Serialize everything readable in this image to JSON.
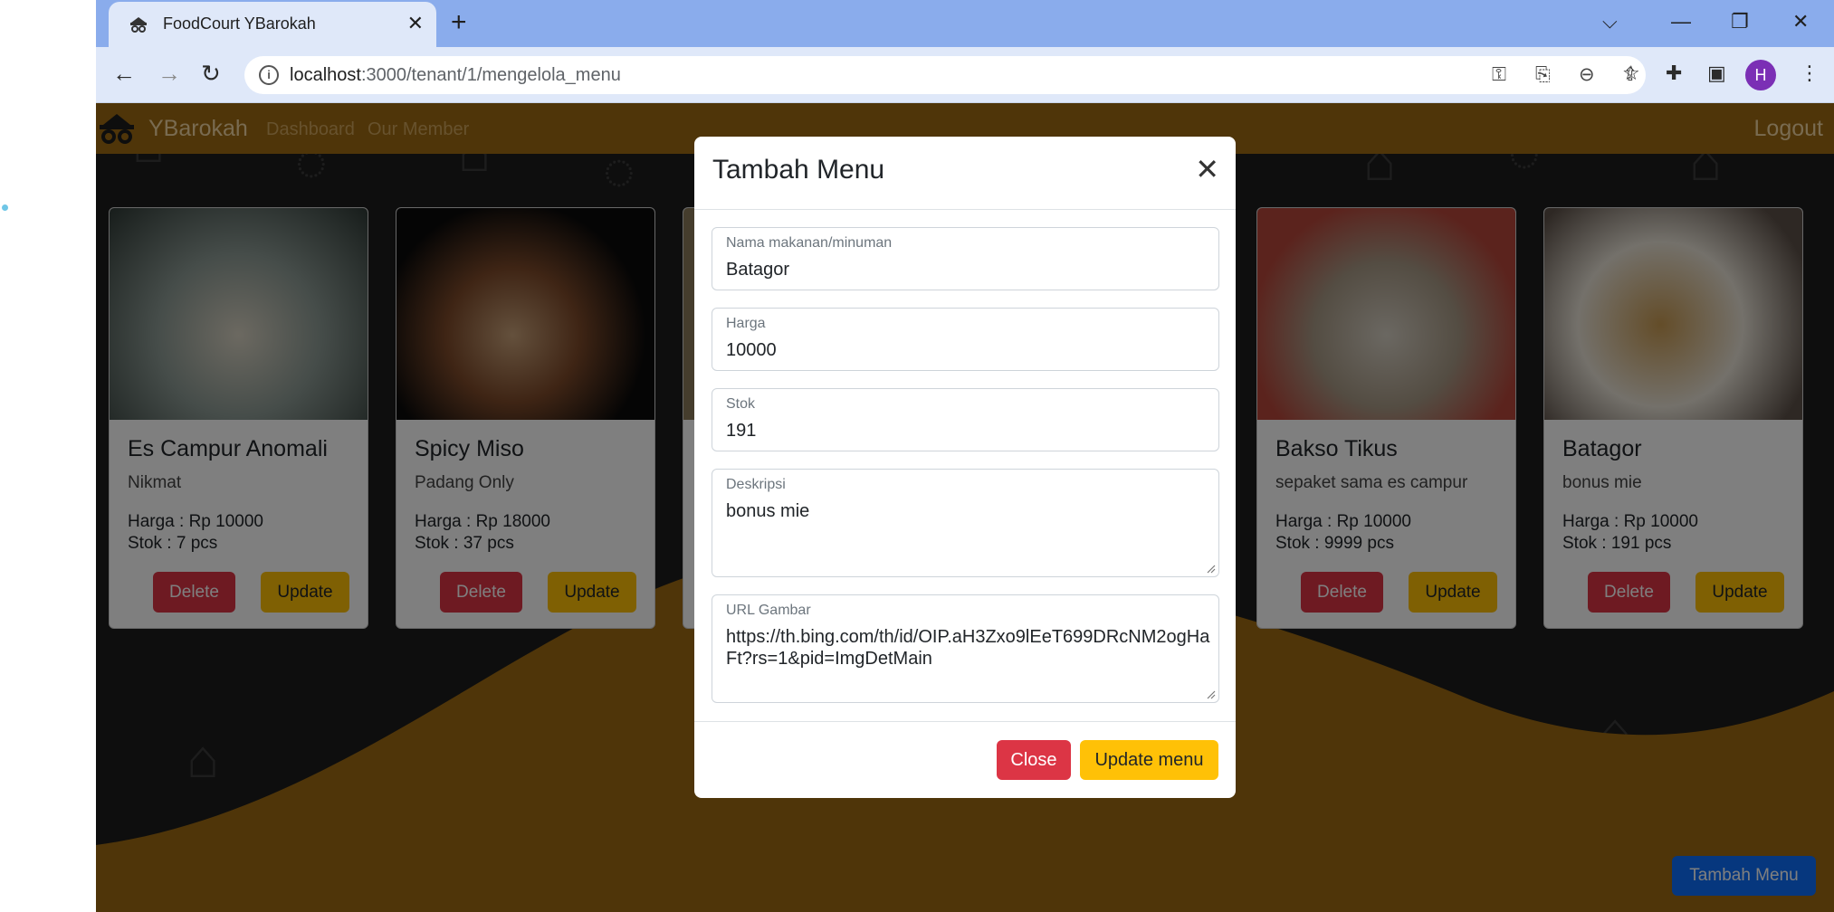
{
  "browser": {
    "tab_title": "FoodCourt YBarokah",
    "tab_close": "✕",
    "new_tab": "+",
    "url_host": "localhost",
    "url_path": ":3000/tenant/1/mengelola_menu",
    "profile_initial": "H"
  },
  "navbar": {
    "brand": "YBarokah",
    "links": [
      "Dashboard",
      "Our Member"
    ],
    "logout": "Logout"
  },
  "cards": [
    {
      "title": "Es Campur Anomali",
      "desc": "Nikmat",
      "price": "Harga : Rp 10000",
      "stock": "Stok : 7 pcs",
      "delete": "Delete",
      "update": "Update",
      "img_color": "#7a8a8a"
    },
    {
      "title": "Spicy Miso",
      "desc": "Padang Only",
      "price": "Harga : Rp 18000",
      "stock": "Stok : 37 pcs",
      "delete": "Delete",
      "update": "Update",
      "img_color": "#2a1a14"
    },
    {
      "title": "Bakso Tikus",
      "desc": "sepaket sama es campur",
      "price": "Harga : Rp 10000",
      "stock": "Stok : 9999 pcs",
      "delete": "Delete",
      "update": "Update",
      "img_color": "#b7463a"
    },
    {
      "title": "Batagor",
      "desc": "bonus mie",
      "price": "Harga : Rp 10000",
      "stock": "Stok : 191 pcs",
      "delete": "Delete",
      "update": "Update",
      "img_color": "#8a7660"
    }
  ],
  "fab_label": "Tambah Menu",
  "modal": {
    "title": "Tambah Menu",
    "close_glyph": "✕",
    "fields": {
      "nama": {
        "label": "Nama makanan/minuman",
        "value": "Batagor"
      },
      "harga": {
        "label": "Harga",
        "value": "10000"
      },
      "stok": {
        "label": "Stok",
        "value": "191"
      },
      "deskripsi": {
        "label": "Deskripsi",
        "value": "bonus mie"
      },
      "url": {
        "label": "URL Gambar",
        "value": "https://th.bing.com/th/id/OIP.aH3Zxo9lEeT699DRcNM2ogHaFt?rs=1&pid=ImgDetMain"
      }
    },
    "close_button": "Close",
    "update_button": "Update menu"
  },
  "colors": {
    "accent_orange": "#9f6b12",
    "danger": "#dc3545",
    "warning": "#ffc107",
    "primary": "#0d6efd"
  }
}
